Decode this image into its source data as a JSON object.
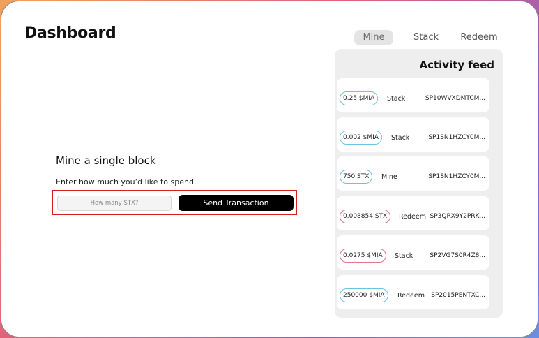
{
  "header": {
    "title": "Dashboard"
  },
  "tabs": [
    {
      "label": "Mine",
      "active": true
    },
    {
      "label": "Stack",
      "active": false
    },
    {
      "label": "Redeem",
      "active": false
    }
  ],
  "feed": {
    "title": "Activity feed",
    "items": [
      {
        "amount": "0.25 $MIA",
        "action": "Stack",
        "address": "SP10WVXDMTCM...",
        "pill_color": "#6cc4dc"
      },
      {
        "amount": "0.002 $MIA",
        "action": "Stack",
        "address": "SP1SN1HZCY0M...",
        "pill_color": "#6cc4dc"
      },
      {
        "amount": "750 STX",
        "action": "Mine",
        "address": "SP1SN1HZCY0M...",
        "pill_color": "#6cc4dc"
      },
      {
        "amount": "0.008854 STX",
        "action": "Redeem",
        "address": "SP3QRX9Y2PRK...",
        "pill_color": "#e07a8a"
      },
      {
        "amount": "0.0275 $MIA",
        "action": "Stack",
        "address": "SP2VG7S0R4Z8...",
        "pill_color": "#e07a8a"
      },
      {
        "amount": "250000 $MIA",
        "action": "Redeem",
        "address": "SP2015PENTXC...",
        "pill_color": "#6cc4dc"
      }
    ]
  },
  "mine": {
    "heading": "Mine a single block",
    "subtext": "Enter how much you’d like to spend.",
    "input_placeholder": "How many STX?",
    "button_label": "Send Transaction"
  }
}
